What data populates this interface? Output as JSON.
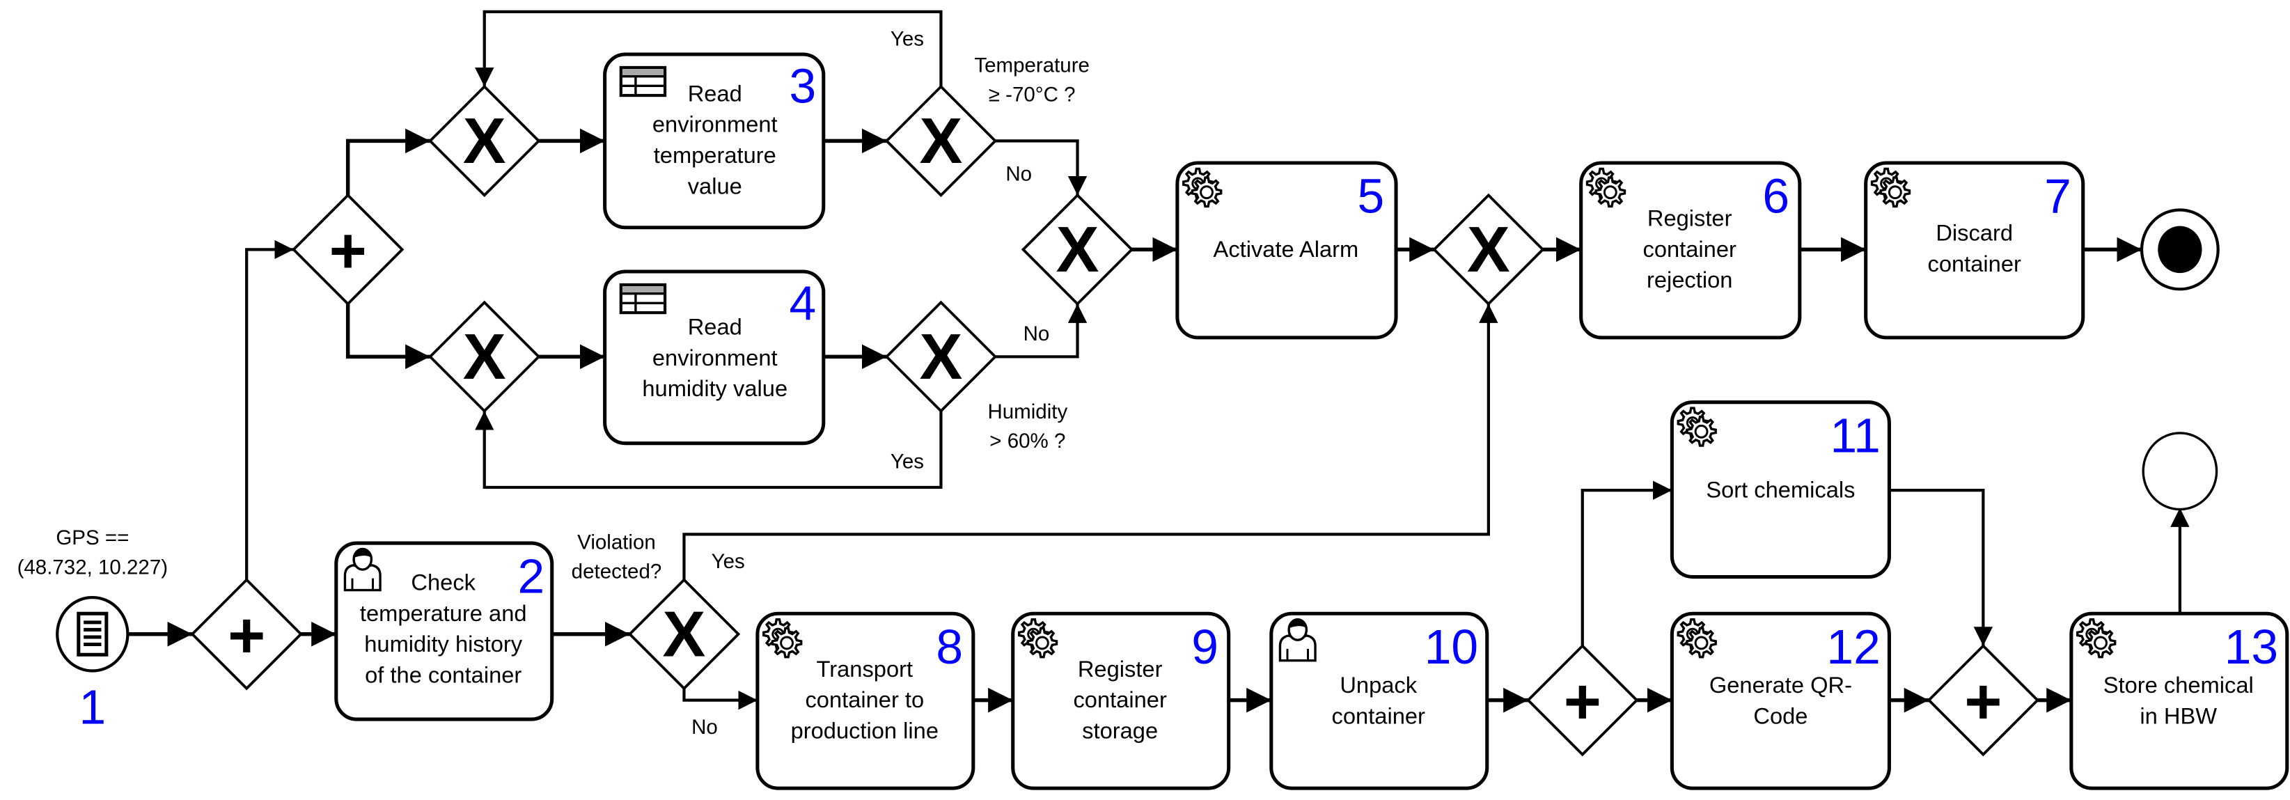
{
  "diagram": {
    "type": "BPMN process",
    "colors": {
      "number": "#0000ff",
      "stroke": "#000000",
      "table_header": "#aaaaaa"
    },
    "start_event": {
      "id": "1",
      "number": "1",
      "icon": "message-list-icon",
      "condition_lines": [
        "GPS ==",
        "(48.732, 10.227)"
      ]
    },
    "tasks": [
      {
        "id": "2",
        "number": "2",
        "type": "user",
        "icon": "user-icon",
        "lines": [
          "Check",
          "temperature and",
          "humidity history",
          "of the container"
        ]
      },
      {
        "id": "3",
        "number": "3",
        "type": "data",
        "icon": "table-icon",
        "lines": [
          "Read",
          "environment",
          "temperature",
          "value"
        ]
      },
      {
        "id": "4",
        "number": "4",
        "type": "data",
        "icon": "table-icon",
        "lines": [
          "Read",
          "environment",
          "humidity value"
        ]
      },
      {
        "id": "5",
        "number": "5",
        "type": "service",
        "icon": "gear-icon",
        "lines": [
          "Activate Alarm"
        ]
      },
      {
        "id": "6",
        "number": "6",
        "type": "service",
        "icon": "gear-icon",
        "lines": [
          "Register",
          "container",
          "rejection"
        ]
      },
      {
        "id": "7",
        "number": "7",
        "type": "service",
        "icon": "gear-icon",
        "lines": [
          "Discard",
          "container"
        ]
      },
      {
        "id": "8",
        "number": "8",
        "type": "service",
        "icon": "gear-icon",
        "lines": [
          "Transport",
          "container to",
          "production line"
        ]
      },
      {
        "id": "9",
        "number": "9",
        "type": "service",
        "icon": "gear-icon",
        "lines": [
          "Register",
          "container",
          "storage"
        ]
      },
      {
        "id": "10",
        "number": "10",
        "type": "user",
        "icon": "user-icon",
        "lines": [
          "Unpack",
          "container"
        ]
      },
      {
        "id": "11",
        "number": "11",
        "type": "service",
        "icon": "gear-icon",
        "lines": [
          "Sort chemicals"
        ]
      },
      {
        "id": "12",
        "number": "12",
        "type": "service",
        "icon": "gear-icon",
        "lines": [
          "Generate QR-",
          "Code"
        ]
      },
      {
        "id": "13",
        "number": "13",
        "type": "service",
        "icon": "gear-icon",
        "lines": [
          "Store chemical",
          "in HBW"
        ]
      }
    ],
    "gateway_labels": {
      "temperature_question": [
        "Temperature",
        "≥ -70°C ?"
      ],
      "humidity_question": [
        "Humidity",
        "> 60% ?"
      ],
      "violation_question": [
        "Violation",
        "detected?"
      ]
    },
    "flow_labels": {
      "temp_yes": "Yes",
      "temp_no": "No",
      "hum_yes": "Yes",
      "hum_no": "No",
      "violation_yes": "Yes",
      "violation_no": "No"
    },
    "gateway_markers": {
      "parallel": "+",
      "exclusive": "X"
    }
  }
}
